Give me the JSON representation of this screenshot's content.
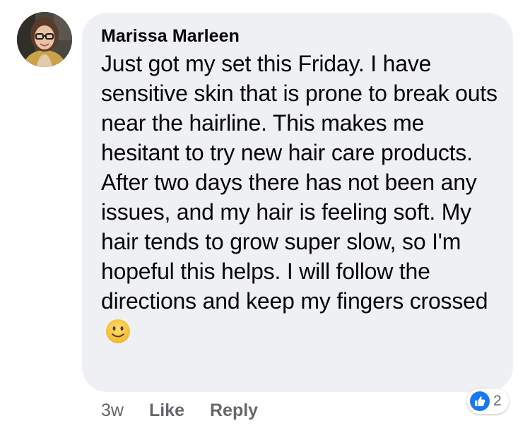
{
  "comment": {
    "author": "Marissa Marleen",
    "text": "Just got my set this Friday. I have sensitive skin that is prone to break outs near the hairline. This makes me hesitant to try new hair care products. After two days there has not been any issues, and my hair is feeling soft. My hair tends to grow super slow, so I'm hopeful this helps. I will follow the directions and keep my fingers crossed",
    "emoji": "slightly-smiling-face-emoji",
    "timestamp": "3w",
    "like_label": "Like",
    "reply_label": "Reply",
    "reactions": {
      "icon": "like-icon",
      "count": "2"
    }
  },
  "colors": {
    "bubble": "#eff0f3",
    "text": "#050505",
    "meta": "#65676b",
    "like_blue": "#1877f2",
    "emoji_yellow": "#f7c948"
  }
}
